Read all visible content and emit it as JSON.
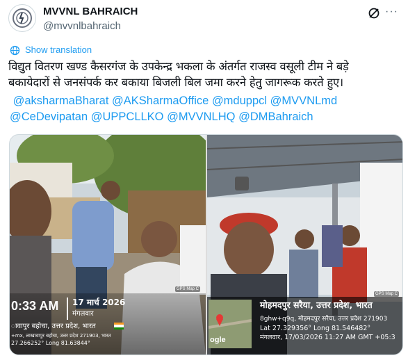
{
  "account": {
    "display_name": "MVVNL BAHRAICH",
    "handle": "@mvvnlbahraich"
  },
  "translate_label": "Show translation",
  "tweet": {
    "line1": "विद्युत वितरण खण्ड कैसरगंज के उपकेन्द्र भकला के अंतर्गत राजस्व वसूली टीम ने बड़े",
    "line2": "बकायेदारों से जनसंपर्क कर बकाया बिजली बिल जमा करने हेतु जागरूक करते हुए।",
    "mentions": [
      "@aksharmaBharat",
      "@AKSharmaOffice",
      "@mduppcl",
      "@MVVNLmd",
      "@CeDevipatan",
      "@UPPCLLKO",
      "@MVVNLHQ",
      "@DMBahraich"
    ]
  },
  "photo_left": {
    "time": "0:33 AM",
    "date": "17 मार्च 2026",
    "weekday": "मंगलवार",
    "place": "ावापुर बहोचा, उत्तर प्रदेश, भारत",
    "address": "+mx, लाखावापुर बहोचा, उत्तर प्रदेश 271903, भारत",
    "coords": "27.266252° Long 81.63844°",
    "badge": "GPS Map C"
  },
  "photo_right": {
    "place": "मोहमदपुर सरैया, उत्तर प्रदेश, भारत",
    "address": "8ghw+q9q, मोहमदपुर सरैया, उत्तर प्रदेश 271903",
    "coords": "Lat 27.329356° Long 81.546482°",
    "datetime": "मंगलवार, 17/03/2026 11:27 AM GMT +05:3",
    "map_label": "ogle",
    "badge": "GPS Map C"
  },
  "colors": {
    "link": "#1d9bf0",
    "secondary": "#536471",
    "text": "#0f1419"
  }
}
